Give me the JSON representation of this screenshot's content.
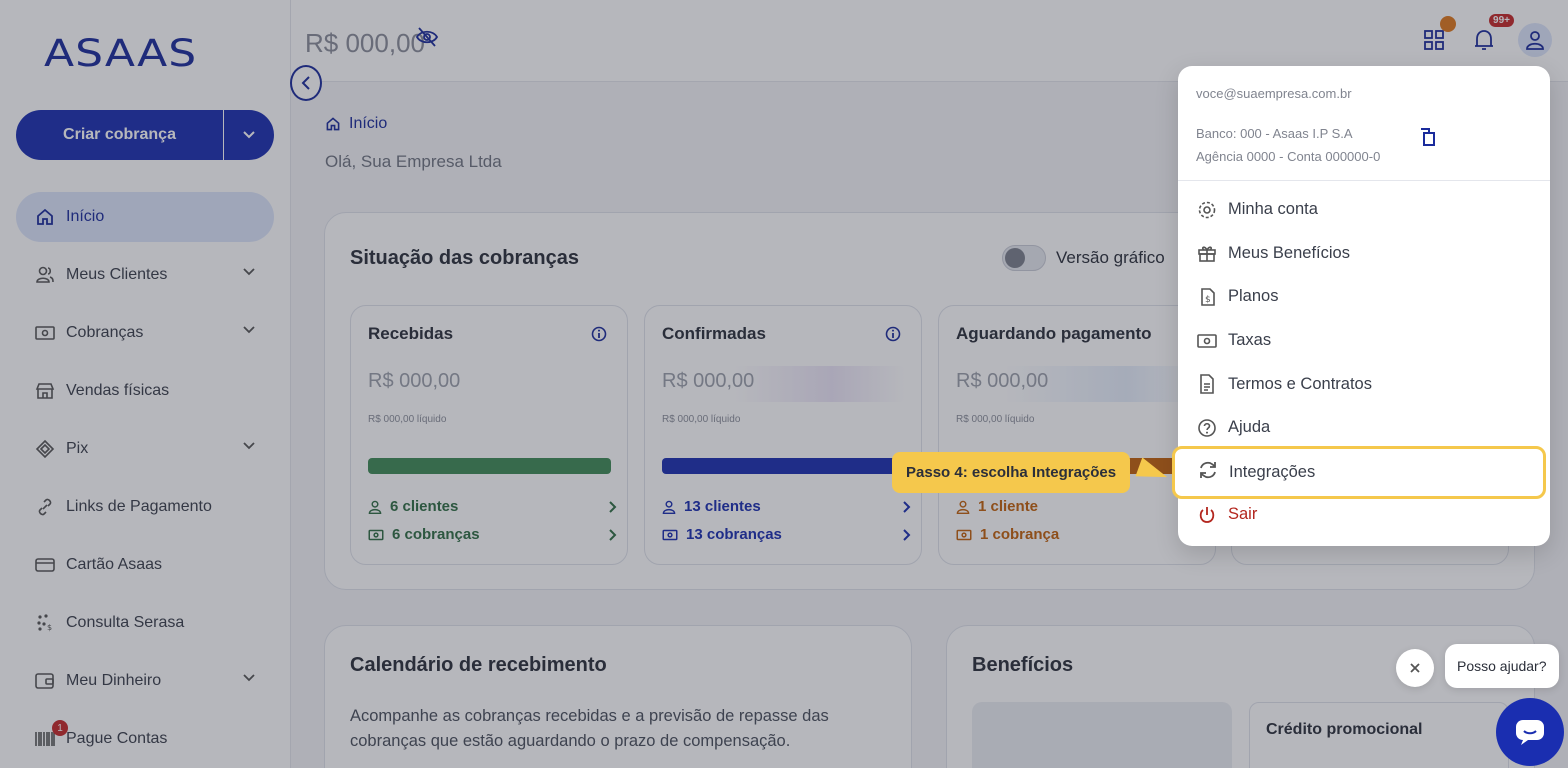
{
  "brand": {
    "logo_text": "ASAAS",
    "primary": "#1a2eb0",
    "accent": "#f5c84c"
  },
  "sidebar": {
    "create_button": "Criar cobrança",
    "items": [
      {
        "label": "Início",
        "icon": "home-icon",
        "active": true
      },
      {
        "label": "Meus Clientes",
        "icon": "users-icon",
        "expandable": true
      },
      {
        "label": "Cobranças",
        "icon": "money-icon",
        "expandable": true
      },
      {
        "label": "Vendas físicas",
        "icon": "store-icon"
      },
      {
        "label": "Pix",
        "icon": "pix-icon",
        "expandable": true
      },
      {
        "label": "Links de Pagamento",
        "icon": "link-icon"
      },
      {
        "label": "Cartão Asaas",
        "icon": "card-icon"
      },
      {
        "label": "Consulta Serasa",
        "icon": "serasa-icon"
      },
      {
        "label": "Meu Dinheiro",
        "icon": "wallet-icon",
        "expandable": true
      },
      {
        "label": "Pague Contas",
        "icon": "barcode-icon",
        "badge": "1"
      }
    ]
  },
  "topbar": {
    "balance": "R$ 000,00",
    "notifications_badge": "99+"
  },
  "main": {
    "breadcrumb": "Início",
    "greeting": "Olá, Sua Empresa Ltda",
    "status_card": {
      "title": "Situação das cobranças",
      "toggle_label": "Versão gráfico",
      "stats": [
        {
          "title": "Recebidas",
          "value": "R$ 000,00",
          "net": "R$ 000,00 líquido",
          "clients": "6 clientes",
          "charges": "6 cobranças",
          "color": "#3f8a55"
        },
        {
          "title": "Confirmadas",
          "value": "R$ 000,00",
          "net": "R$ 000,00 líquido",
          "clients": "13 clientes",
          "charges": "13 cobranças",
          "color": "#1a2eb0"
        },
        {
          "title": "Aguardando pagamento",
          "value": "R$ 000,00",
          "net": "R$ 000,00 líquido",
          "clients": "1 cliente",
          "charges": "1 cobrança",
          "color": "#c2620c"
        }
      ]
    },
    "calendar_card": {
      "title": "Calendário de recebimento",
      "text": "Acompanhe as cobranças recebidas e a previsão de repasse das cobranças que estão aguardando o prazo de compensação."
    },
    "benefits_card": {
      "title": "Benefícios",
      "promo_title": "Crédito promocional"
    }
  },
  "account_menu": {
    "email": "voce@suaempresa.com.br",
    "bank_line": "Banco: 000 - Asaas I.P S.A",
    "agency_line": "Agência 0000 - Conta 000000-0",
    "items": [
      {
        "label": "Minha conta",
        "icon": "gear-icon"
      },
      {
        "label": "Meus Benefícios",
        "icon": "gift-icon"
      },
      {
        "label": "Planos",
        "icon": "plan-icon"
      },
      {
        "label": "Taxas",
        "icon": "money-icon"
      },
      {
        "label": "Termos e Contratos",
        "icon": "document-icon"
      },
      {
        "label": "Ajuda",
        "icon": "help-icon"
      },
      {
        "label": "Integrações",
        "icon": "sync-icon"
      },
      {
        "label": "Sair",
        "icon": "power-icon"
      }
    ]
  },
  "tour": {
    "step_text": "Passo 4: escolha Integrações"
  },
  "help_widget": {
    "bubble_text": "Posso ajudar?"
  }
}
